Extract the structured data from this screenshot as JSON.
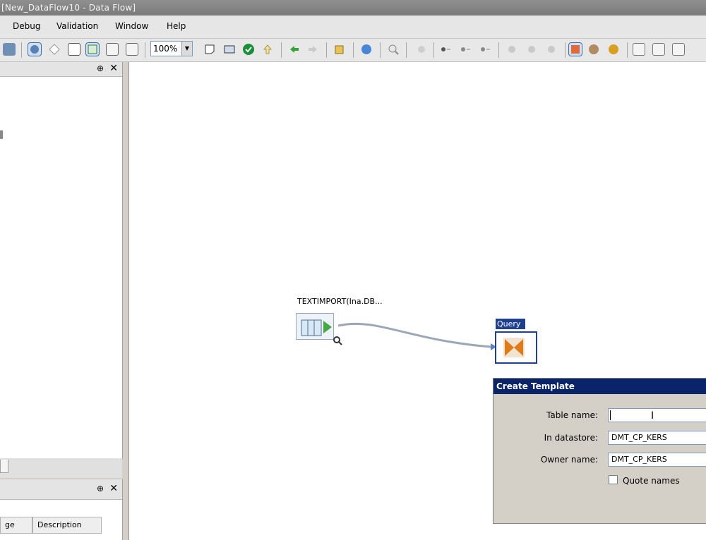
{
  "window": {
    "title": "[New_DataFlow10 - Data Flow]"
  },
  "menu": {
    "items": [
      {
        "label": "Debug"
      },
      {
        "label": "Validation"
      },
      {
        "label": "Window"
      },
      {
        "label": "Help"
      }
    ]
  },
  "toolbar": {
    "zoom_value": "100%"
  },
  "left_panel": {
    "bottom_columns": [
      "ge",
      "Description"
    ]
  },
  "canvas": {
    "source_node_label": "TEXTIMPORT(Ina.DB...",
    "query_node_label": "Query"
  },
  "dialog": {
    "title": "Create Template",
    "table_name_label": "Table name:",
    "table_name_value": "",
    "datastore_label": "In datastore:",
    "datastore_value": "DMT_CP_KERS",
    "owner_label": "Owner name:",
    "owner_value": "DMT_CP_KERS",
    "quote_names_label": "Quote names"
  },
  "colors": {
    "dialog_title_bg": "#0a246a",
    "query_accent": "#1f3f8f",
    "arrow": "#e07b1a"
  }
}
